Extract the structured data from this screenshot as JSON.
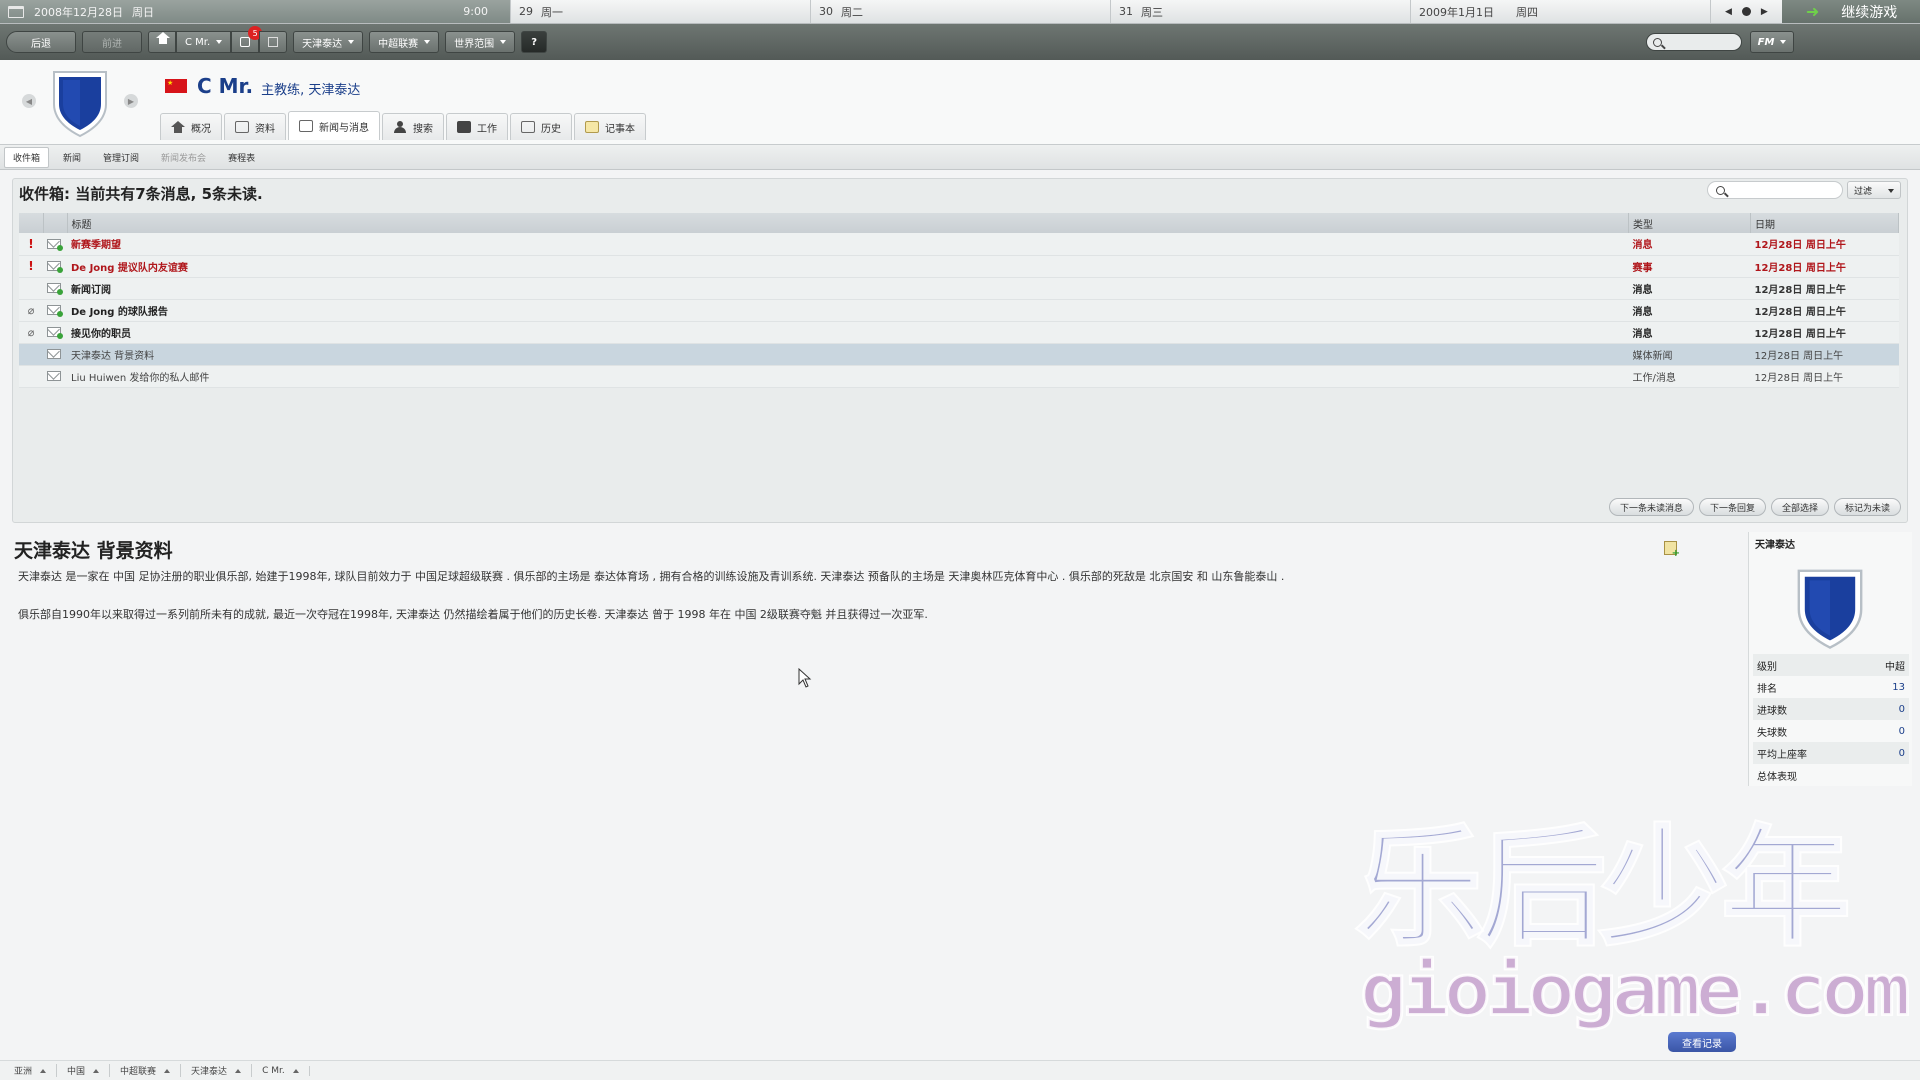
{
  "datebar": {
    "today_date": "2008年12月28日",
    "today_weekday": "周日",
    "time": "9:00",
    "days": [
      {
        "date": "29",
        "weekday": "周一"
      },
      {
        "date": "30",
        "weekday": "周二"
      },
      {
        "date": "31",
        "weekday": "周三"
      },
      {
        "date": "2009年1月1日",
        "weekday": "周四"
      }
    ],
    "continue_label": "继续游戏"
  },
  "toolbar": {
    "back_label": "后退",
    "forward_label": "前进",
    "manager_label": "C Mr.",
    "inbox_badge": "5",
    "club_label": "天津泰达",
    "league_label": "中超联赛",
    "world_label": "世界范围",
    "help_label": "?",
    "fm_label": "FM"
  },
  "profile": {
    "name": "C Mr.",
    "role": "主教练, 天津泰达",
    "tabs": [
      {
        "label": "概况",
        "icon": "home-icon"
      },
      {
        "label": "资料",
        "icon": "profile-card-icon"
      },
      {
        "label": "新闻与消息",
        "icon": "news-icon"
      },
      {
        "label": "搜索",
        "icon": "person-search-icon"
      },
      {
        "label": "工作",
        "icon": "briefcase-icon"
      },
      {
        "label": "历史",
        "icon": "history-icon"
      },
      {
        "label": "记事本",
        "icon": "notepad-icon"
      }
    ]
  },
  "subtabs": [
    "收件箱",
    "新闻",
    "管理订阅",
    "新闻发布会",
    "赛程表"
  ],
  "inbox": {
    "header": "收件箱: 当前共有7条消息, 5条未读.",
    "filter_label": "过滤",
    "columns": {
      "title": "标题",
      "type": "类型",
      "date": "日期"
    },
    "messages": [
      {
        "title": "新赛季期望",
        "type": "消息",
        "date": "12月28日 周日上午"
      },
      {
        "title": "De Jong 提议队内友谊赛",
        "type": "赛事",
        "date": "12月28日 周日上午"
      },
      {
        "title": "新闻订阅",
        "type": "消息",
        "date": "12月28日 周日上午"
      },
      {
        "title": "De Jong 的球队报告",
        "type": "消息",
        "date": "12月28日 周日上午"
      },
      {
        "title": "接见你的职员",
        "type": "消息",
        "date": "12月28日 周日上午"
      },
      {
        "title": "天津泰达 背景资料",
        "type": "媒体新闻",
        "date": "12月28日 周日上午"
      },
      {
        "title": "Liu Huiwen 发给你的私人邮件",
        "type": "工作/消息",
        "date": "12月28日 周日上午"
      }
    ],
    "actions": [
      "下一条未读消息",
      "下一条回复",
      "全部选择",
      "标记为未读"
    ]
  },
  "article": {
    "title": "天津泰达 背景资料",
    "para1": "天津泰达 是一家在 中国 足协注册的职业俱乐部, 始建于1998年, 球队目前效力于 中国足球超级联赛 . 俱乐部的主场是 泰达体育场 , 拥有合格的训练设施及青训系统. 天津泰达 预备队的主场是 天津奥林匹克体育中心 . 俱乐部的死敌是 北京国安 和 山东鲁能泰山 .",
    "para2": "俱乐部自1990年以来取得过一系列前所未有的成就, 最近一次夺冠在1998年, 天津泰达 仍然描绘着属于他们的历史长卷. 天津泰达 曾于 1998 年在 中国 2级联赛夺魁 并且获得过一次亚军."
  },
  "club": {
    "name": "天津泰达",
    "stats": [
      {
        "label": "级别",
        "value": "中超"
      },
      {
        "label": "排名",
        "value": "13"
      },
      {
        "label": "进球数",
        "value": "0"
      },
      {
        "label": "失球数",
        "value": "0"
      },
      {
        "label": "平均上座率",
        "value": "0"
      },
      {
        "label": "总体表现",
        "value": ""
      }
    ]
  },
  "watermark": {
    "brand": "乐后少年",
    "url": "gioiogame.com",
    "record_label": "查看记录"
  },
  "breadcrumbs": [
    "亚洲",
    "中国",
    "中超联赛",
    "天津泰达",
    "C Mr."
  ],
  "colors": {
    "urgent_red": "#b0161b",
    "link_blue": "#1b3f8a",
    "crest_blue": "#1a3f9e",
    "toolbar_gray": "#5f6763"
  }
}
